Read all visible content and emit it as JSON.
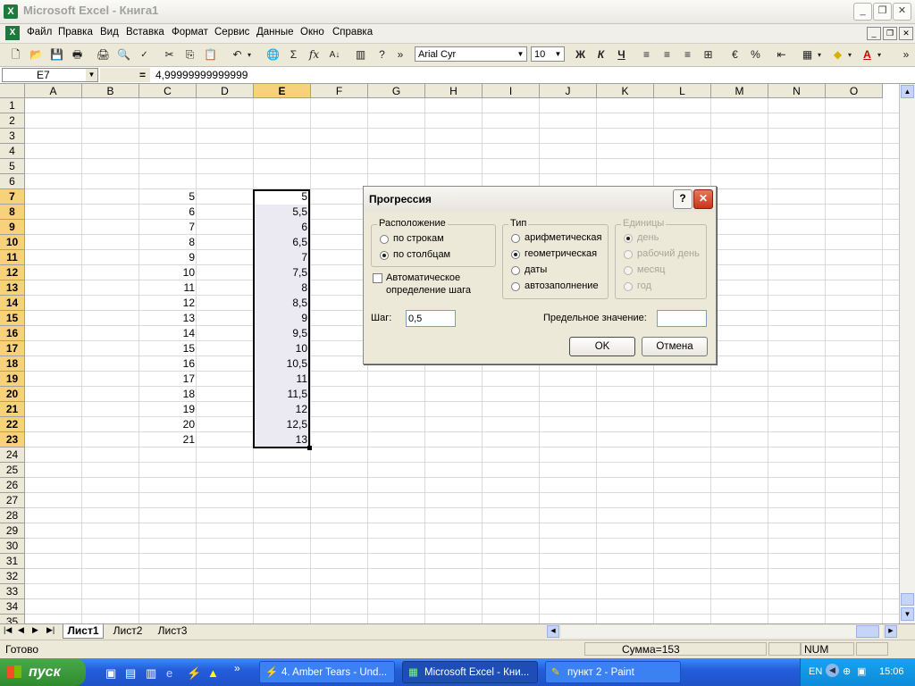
{
  "window": {
    "title": "Microsoft Excel - Книга1"
  },
  "menu": [
    "Файл",
    "Правка",
    "Вид",
    "Вставка",
    "Формат",
    "Сервис",
    "Данные",
    "Окно",
    "Справка"
  ],
  "toolbar": {
    "font_name": "Arial Cyr",
    "font_size": "10",
    "bold": "Ж",
    "italic": "К",
    "underline": "Ч",
    "percent": "%"
  },
  "formula_bar": {
    "name_box": "E7",
    "equals": "=",
    "value": "4,99999999999999"
  },
  "columns": [
    "A",
    "B",
    "C",
    "D",
    "E",
    "F",
    "G",
    "H",
    "I",
    "J",
    "K",
    "L",
    "M",
    "N",
    "O"
  ],
  "rows": [
    "1",
    "2",
    "3",
    "4",
    "5",
    "6",
    "7",
    "8",
    "9",
    "10",
    "11",
    "12",
    "13",
    "14",
    "15",
    "16",
    "17",
    "18",
    "19",
    "20",
    "21",
    "22",
    "23",
    "24",
    "25",
    "26",
    "27",
    "28",
    "29",
    "30",
    "31",
    "32",
    "33",
    "34",
    "35"
  ],
  "column_c_values": [
    "5",
    "6",
    "7",
    "8",
    "9",
    "10",
    "11",
    "12",
    "13",
    "14",
    "15",
    "16",
    "17",
    "18",
    "19",
    "20",
    "21"
  ],
  "column_e_values": [
    "5",
    "5,5",
    "6",
    "6,5",
    "7",
    "7,5",
    "8",
    "8,5",
    "9",
    "9,5",
    "10",
    "10,5",
    "11",
    "11,5",
    "12",
    "12,5",
    "13"
  ],
  "sheets": [
    "Лист1",
    "Лист2",
    "Лист3"
  ],
  "status": {
    "ready": "Готово",
    "sum": "Сумма=153",
    "num": "NUM"
  },
  "dialog": {
    "title": "Прогрессия",
    "help": "?",
    "location_group": "Расположение",
    "by_rows": "по строкам",
    "by_columns": "по столбцам",
    "type_group": "Тип",
    "arithmetic": "арифметическая",
    "geometric": "геометрическая",
    "dates": "даты",
    "autofill": "автозаполнение",
    "units_group": "Единицы",
    "day": "день",
    "workday": "рабочий день",
    "month": "месяц",
    "year": "год",
    "auto_step_line1": "Автоматическое",
    "auto_step_line2": "определение шага",
    "step_label": "Шаг:",
    "step_value": "0,5",
    "limit_label": "Предельное значение:",
    "limit_value": "",
    "ok": "OK",
    "cancel": "Отмена"
  },
  "taskbar": {
    "start": "пуск",
    "tasks": [
      "4. Amber Tears - Und...",
      "Microsoft Excel - Кни...",
      "пункт 2 - Paint"
    ],
    "lang": "EN",
    "clock": "15:06"
  }
}
